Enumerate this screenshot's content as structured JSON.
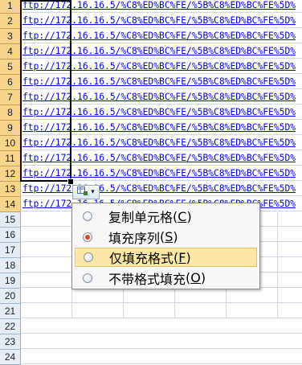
{
  "rows": [
    {
      "num": "1",
      "text": "ftp://172.16.16.5/%C8%ED%BC%FE/%5B%C8%ED%BC%FE%5D%"
    },
    {
      "num": "2",
      "text": "ftp://172.16.16.5/%C8%ED%BC%FE/%5B%C8%ED%BC%FE%5D%"
    },
    {
      "num": "3",
      "text": "ftp://172.16.16.5/%C8%ED%BC%FE/%5B%C8%ED%BC%FE%5D%"
    },
    {
      "num": "4",
      "text": "ftp://172.16.16.5/%C8%ED%BC%FE/%5B%C8%ED%BC%FE%5D%"
    },
    {
      "num": "5",
      "text": "ftp://172.16.16.5/%C8%ED%BC%FE/%5B%C8%ED%BC%FE%5D%"
    },
    {
      "num": "6",
      "text": "ftp://172.16.16.5/%C8%ED%BC%FE/%5B%C8%ED%BC%FE%5D%"
    },
    {
      "num": "7",
      "text": "ftp://172.16.16.5/%C8%ED%BC%FE/%5B%C8%ED%BC%FE%5D%"
    },
    {
      "num": "8",
      "text": "ftp://172.16.16.5/%C8%ED%BC%FE/%5B%C8%ED%BC%FE%5D%"
    },
    {
      "num": "9",
      "text": "ftp://172.16.16.5/%C8%ED%BC%FE/%5B%C8%ED%BC%FE%5D%"
    },
    {
      "num": "10",
      "text": "ftp://172.16.16.5/%C8%ED%BC%FE/%5B%C8%ED%BC%FE%5D%"
    },
    {
      "num": "11",
      "text": "ftp://172.16.16.5/%C8%ED%BC%FE/%5B%C8%ED%BC%FE%5D%"
    },
    {
      "num": "12",
      "text": "ftp://172.16.16.5/%C8%ED%BC%FE/%5B%C8%ED%BC%FE%5D%"
    },
    {
      "num": "13",
      "text": "ftp://172.16.16.5/%C8%ED%BC%FE/%5B%C8%ED%BC%FE%5D%"
    },
    {
      "num": "14",
      "text": "ftp://172.16.16.5/%C8%ED%BC%FE/%5B%C8%ED%BC%FE%5D%"
    },
    {
      "num": "15",
      "text": ""
    },
    {
      "num": "16",
      "text": ""
    },
    {
      "num": "17",
      "text": ""
    },
    {
      "num": "18",
      "text": ""
    },
    {
      "num": "19",
      "text": ""
    },
    {
      "num": "20",
      "text": ""
    },
    {
      "num": "21",
      "text": ""
    },
    {
      "num": "22",
      "text": ""
    },
    {
      "num": "23",
      "text": ""
    },
    {
      "num": "24",
      "text": ""
    }
  ],
  "autofill_button": {
    "icon": "autofill-options-icon",
    "arrow": "▾"
  },
  "menu": {
    "items": [
      {
        "label": "复制单元格",
        "key": "C",
        "selected": false
      },
      {
        "label": "填充序列",
        "key": "S",
        "selected": true
      },
      {
        "label": "仅填充格式",
        "key": "F",
        "selected": false
      },
      {
        "label": "不带格式填充",
        "key": "O",
        "selected": false
      }
    ],
    "hover_index": 2
  },
  "colors": {
    "selected_row_header": "#f8d38b",
    "row_header": "#e6ecf5",
    "hyperlink": "#0000ee",
    "menu_hover": "#fde7a7",
    "radio_on": "#d64a24"
  }
}
